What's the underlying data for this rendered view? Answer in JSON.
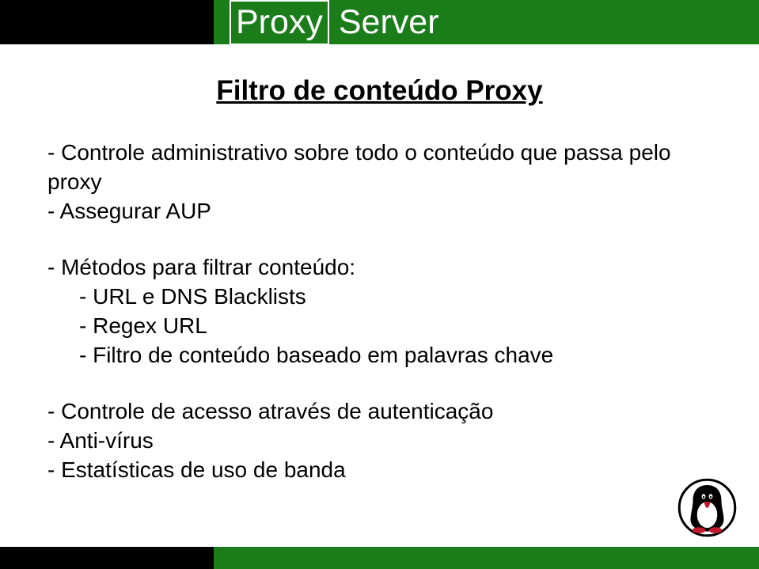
{
  "header": {
    "title_word1": "Proxy",
    "title_word2": "Server"
  },
  "subtitle": "Filtro de conteúdo Proxy",
  "body": {
    "l1": "- Controle administrativo sobre todo o conteúdo que passa pelo proxy",
    "l2": "- Assegurar AUP",
    "l3": "- Métodos para filtrar conteúdo:",
    "l3a": "- URL e DNS Blacklists",
    "l3b": "- Regex URL",
    "l3c": "- Filtro de conteúdo baseado em palavras chave",
    "l4": "- Controle de acesso através de autenticação",
    "l5": "- Anti-vírus",
    "l6": "- Estatísticas de uso de banda"
  },
  "logo_name": "penguin-logo"
}
